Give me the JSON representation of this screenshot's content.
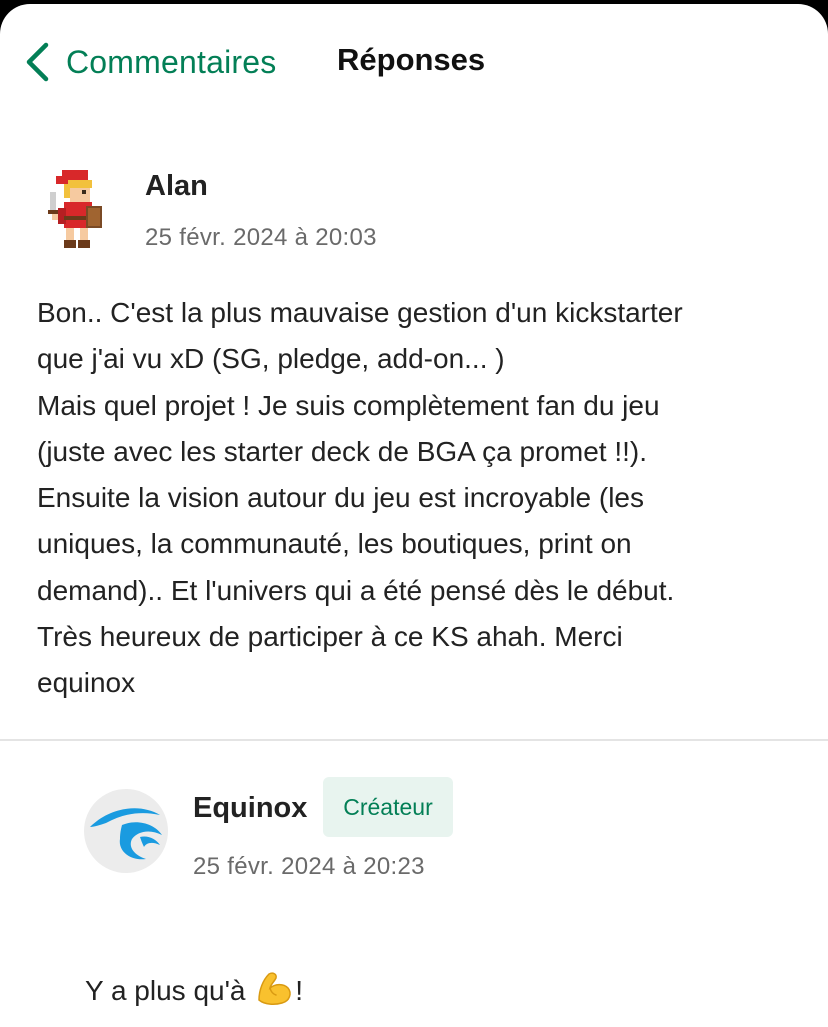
{
  "header": {
    "back_label": "Commentaires",
    "title": "Réponses"
  },
  "comment": {
    "author": "Alan",
    "timestamp": "25 févr. 2024 à 20:03",
    "body": "Bon.. C'est la plus mauvaise gestion d'un kickstarter\nque j'ai vu xD (SG, pledge, add-on... )\nMais quel projet ! Je suis complètement fan du jeu\n(juste avec les starter deck de BGA ça promet !!).\nEnsuite la vision autour du jeu est incroyable (les\nuniques, la communauté, les boutiques, print on\ndemand).. Et l'univers qui a été pensé dès le début.\nTrès heureux de participer à ce KS ahah. Merci\nequinox"
  },
  "reply": {
    "author": "Equinox",
    "badge": "Créateur",
    "timestamp": "25 févr. 2024 à 20:23",
    "body_before": "Y a plus qu'à ",
    "body_emoji": "flexed-biceps-emoji",
    "body_after": "!"
  },
  "colors": {
    "accent": "#037f56",
    "badge_bg": "#e8f4ef",
    "text": "#222222",
    "muted": "#6a6a6a",
    "logo_blue": "#1a9be0"
  }
}
